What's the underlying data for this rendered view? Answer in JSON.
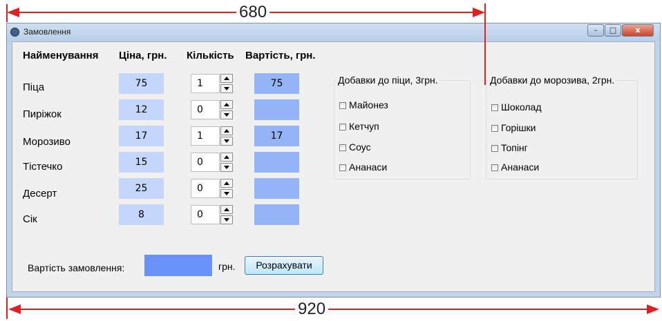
{
  "dimensions": {
    "top": "680",
    "bottom": "920"
  },
  "window": {
    "title": "Замовлення",
    "controls": {
      "minimize": "–",
      "maximize": "□",
      "close": "x"
    }
  },
  "headers": {
    "name": "Найменування",
    "price": "Ціна, грн.",
    "qty": "Кількість",
    "cost": "Вартість, грн."
  },
  "items": [
    {
      "name": "Піца",
      "price": "75",
      "qty": "1",
      "cost": "75"
    },
    {
      "name": "Пиріжок",
      "price": "12",
      "qty": "0",
      "cost": ""
    },
    {
      "name": "Морозиво",
      "price": "17",
      "qty": "1",
      "cost": "17"
    },
    {
      "name": "Тістечко",
      "price": "15",
      "qty": "0",
      "cost": ""
    },
    {
      "name": "Десерт",
      "price": "25",
      "qty": "0",
      "cost": ""
    },
    {
      "name": "Сік",
      "price": "8",
      "qty": "0",
      "cost": ""
    }
  ],
  "pizza_addons": {
    "title": "Добавки до піци, 3грн.",
    "options": [
      "Майонез",
      "Кетчуп",
      "Соус",
      "Ананаси"
    ]
  },
  "icecream_addons": {
    "title": "Добавки до морозива, 2грн.",
    "options": [
      "Шоколад",
      "Горішки",
      "Топінг",
      "Ананаси"
    ]
  },
  "total": {
    "label": "Вартість замовлення:",
    "value": "",
    "currency": "грн.",
    "button": "Розрахувати"
  },
  "colors": {
    "price_field": "#c4d6fb",
    "cost_field": "#95b3f7",
    "total_field": "#6892fa",
    "annotation": "#e02020"
  }
}
